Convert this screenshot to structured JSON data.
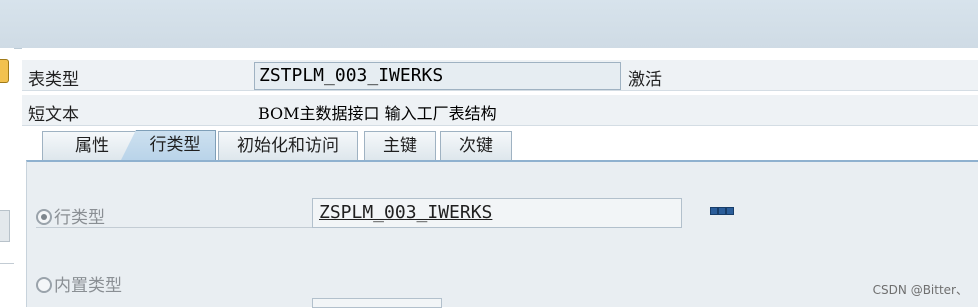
{
  "header": {
    "table_type_label": "表类型",
    "table_type_value": "ZSTPLM_003_IWERKS",
    "status": "激活",
    "short_text_label": "短文本",
    "short_text_value": "BOM主数据接口 输入工厂表结构"
  },
  "tabs": [
    {
      "label": "属性",
      "active": false
    },
    {
      "label": "行类型",
      "active": true
    },
    {
      "label": "初始化和访问",
      "active": false
    },
    {
      "label": "主键",
      "active": false
    },
    {
      "label": "次键",
      "active": false
    }
  ],
  "row_type_section": {
    "row_type_option": "行类型",
    "row_type_selected": true,
    "row_type_value": "ZSPLM_003_IWERKS",
    "builtin_type_option": "内置类型",
    "builtin_type_selected": false
  },
  "watermark": "CSDN @Bitter、",
  "colors": {
    "active_tab": "#b8d3e9",
    "panel_bg": "#e9eef2",
    "field_bg": "#e6edf2"
  },
  "icons": {
    "more": "more-options-icon"
  }
}
